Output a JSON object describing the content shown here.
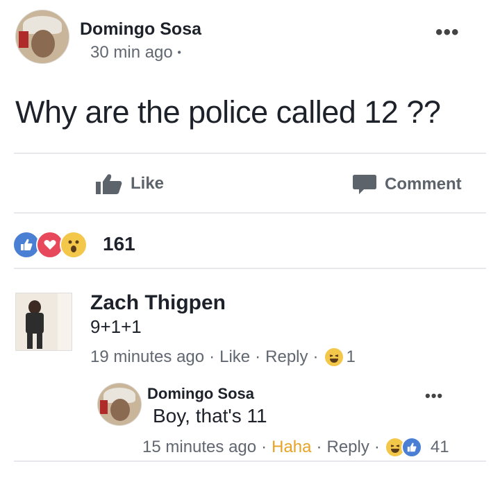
{
  "post": {
    "author": "Domingo Sosa",
    "time": "30 min ago",
    "time_suffix": "•",
    "more": "•••",
    "text": "Why are the police called 12 ??"
  },
  "actions": {
    "like_label": "Like",
    "comment_label": "Comment"
  },
  "reactions": {
    "icons": [
      "like-reaction",
      "love-reaction",
      "wow-reaction"
    ],
    "count": "161"
  },
  "comments": [
    {
      "author": "Zach Thigpen",
      "text": "9+1+1",
      "time": "19 minutes ago",
      "sep": "·",
      "like": "Like",
      "reply": "Reply",
      "reaction_count": "1"
    },
    {
      "author": "Domingo Sosa",
      "text": "Boy, that's 11",
      "time": "15 minutes ago",
      "sep": "·",
      "reaction": "Haha",
      "reply": "Reply",
      "reaction_count": "41",
      "more": "•••"
    }
  ],
  "colors": {
    "like_blue": "#4a7fd4",
    "love_red": "#e8485c",
    "wow_yellow": "#f3c74a",
    "haha_orange": "#e7a325",
    "meta_gray": "#616770"
  }
}
